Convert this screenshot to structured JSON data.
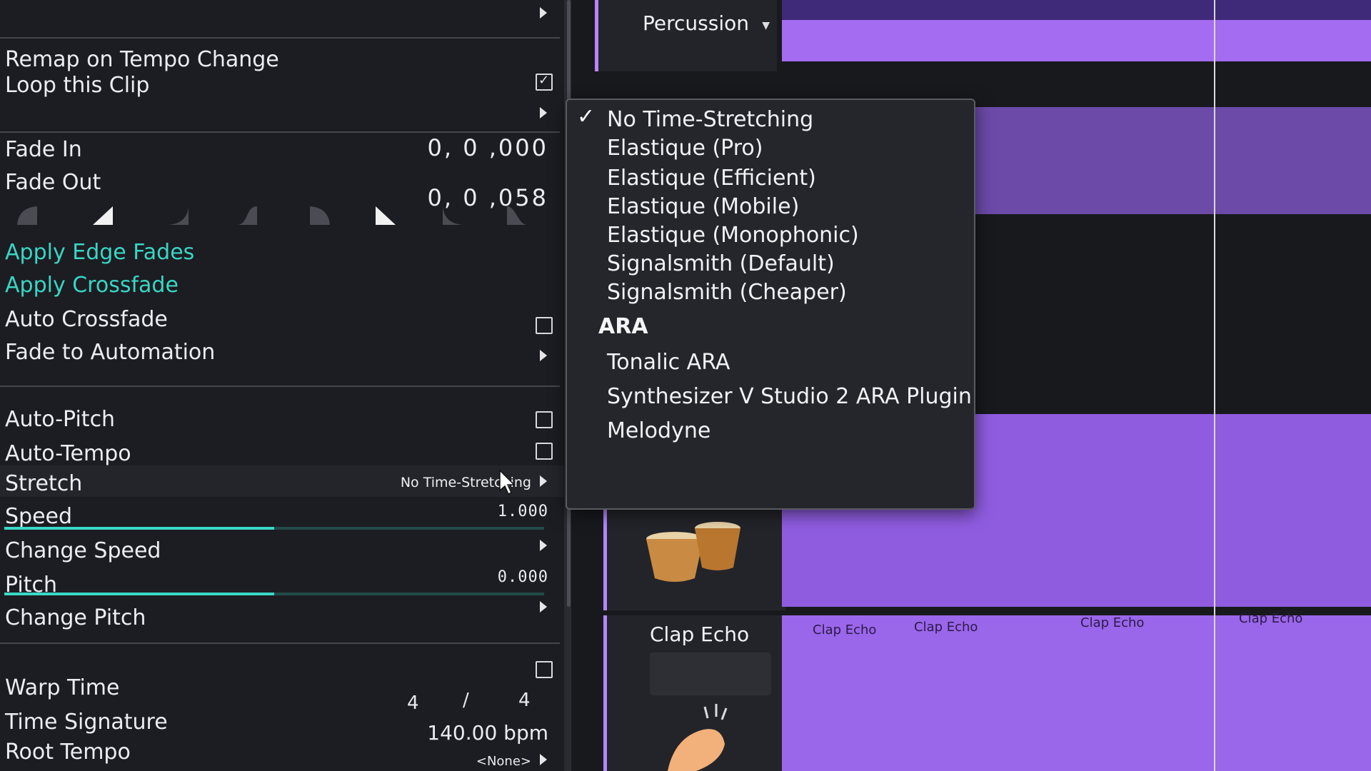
{
  "panel": {
    "remap_label": "Remap on Tempo Change",
    "loop_label": "Loop this Clip",
    "loop_checked": true,
    "fade_in_label": "Fade In",
    "fade_out_label": "Fade Out",
    "fade_in_value": "0, 0 ,000",
    "fade_out_value": "0, 0 ,058",
    "apply_edge_fades": "Apply Edge Fades",
    "apply_crossfade": "Apply Crossfade",
    "auto_crossfade": "Auto Crossfade",
    "fade_to_automation": "Fade to Automation",
    "auto_pitch": "Auto-Pitch",
    "auto_tempo": "Auto-Tempo",
    "stretch_label": "Stretch",
    "stretch_value": "No Time-Stretching",
    "speed_label": "Speed",
    "speed_value": "1.000",
    "speed_level": 0.5,
    "change_speed": "Change Speed",
    "pitch_label": "Pitch",
    "pitch_value": "0.000",
    "pitch_level": 0.5,
    "change_pitch": "Change Pitch",
    "warp_time": "Warp Time",
    "time_signature_label": "Time Signature",
    "ts_numerator": "4",
    "ts_slash": "/",
    "ts_denominator": "4",
    "tempo_value": "140.00 bpm",
    "root_tempo_label": "Root Tempo",
    "root_tempo_value": "<None>"
  },
  "tracks": {
    "percussion": "Percussion",
    "clap_echo": "Clap Echo",
    "clip_labels": [
      "Clap Echo",
      "Clap Echo",
      "Clap Echo",
      "Clap Echo"
    ]
  },
  "menu": {
    "items": [
      "No Time-Stretching",
      "Elastique (Pro)",
      "Elastique (Efficient)",
      "Elastique (Mobile)",
      "Elastique (Monophonic)",
      "Signalsmith (Default)",
      "Signalsmith (Cheaper)"
    ],
    "selected": "No Time-Stretching",
    "section_header": "ARA",
    "ara_items": [
      "Tonalic ARA",
      "Synthesizer V Studio 2 ARA Plugin",
      "Melodyne"
    ]
  },
  "colors": {
    "accent_teal": "#39d6c5",
    "clip_purple": "#8b58d8",
    "track_strip": "#b586ff"
  }
}
